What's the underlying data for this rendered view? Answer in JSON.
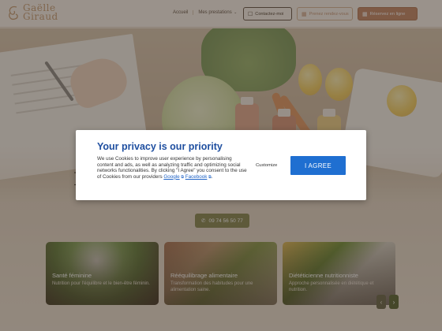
{
  "brand": {
    "line1": "Gaëlle",
    "line2": "Giraud"
  },
  "nav": {
    "home": "Accueil",
    "services": "Mes prestations"
  },
  "header_buttons": {
    "contact": "Contactez-moi",
    "appointment": "Prenez rendez-vous",
    "book_online": "Réservez en ligne"
  },
  "hero": {
    "title_left_fragment": "D",
    "title_right_fragment": "!",
    "phone": "09 74 56 50 77"
  },
  "cards": [
    {
      "title": "Santé féminine",
      "desc": "Nutrition pour l'équilibre et le bien-être féminin."
    },
    {
      "title": "Rééquilibrage alimentaire",
      "desc": "Transformation des habitudes pour une alimentation saine."
    },
    {
      "title": "Diététicienne nutritionniste",
      "desc": "Approche personnalisée en diététique et nutrition."
    }
  ],
  "carousel": {
    "prev": "‹",
    "next": "›"
  },
  "consent": {
    "title": "Your privacy is our priority",
    "body_text": "We use Cookies to improve user experience by personalising content and ads, as well as analyzing traffic and optimizing social networks functionalities. By clicking \"I Agree\" you consent to the use of Cookies from our providers",
    "provider_google": "Google",
    "provider_facebook": "Facebook",
    "customize_label": "Customize",
    "agree_label": "I AGREE"
  },
  "colors": {
    "accent": "#c58b6b",
    "consent_title": "#1f4fa0",
    "agree_button": "#1f6fd1",
    "phone_pill": "#8a8a56"
  },
  "icons": {
    "contact": "chat-icon",
    "appointment": "calendar-icon",
    "book_online": "calendar-icon",
    "phone": "phone-icon",
    "external": "external-link-icon"
  }
}
